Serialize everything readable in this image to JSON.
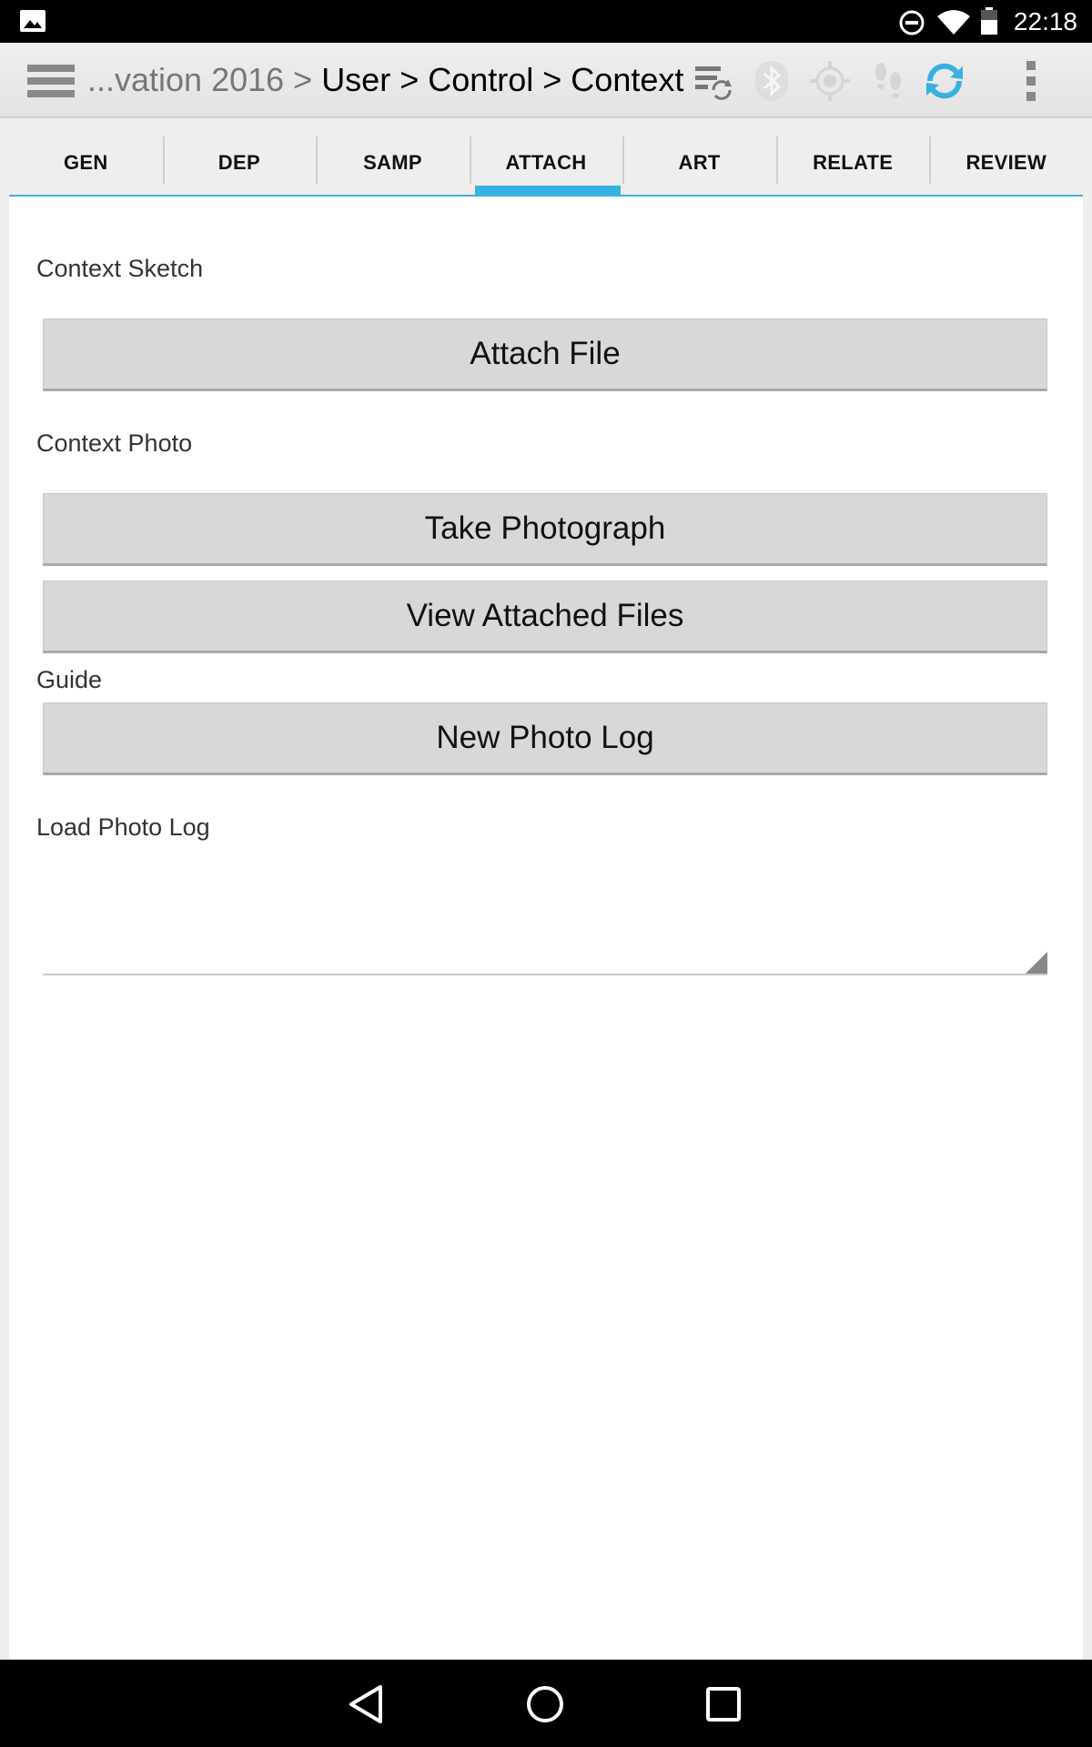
{
  "status_bar": {
    "time": "22:18",
    "icons": [
      "image-icon",
      "do-not-disturb-icon",
      "wifi-icon",
      "battery-icon"
    ]
  },
  "action_bar": {
    "breadcrumb_faded": "...vation 2016 > ",
    "breadcrumb_path": "User > Control > Context",
    "icons": [
      "menu-icon",
      "sync-list-icon",
      "bluetooth-icon",
      "gps-icon",
      "tracks-icon",
      "refresh-icon",
      "overflow-menu-icon"
    ],
    "accent_color": "#36b1e2"
  },
  "tabs": [
    {
      "label": "GEN",
      "active": false
    },
    {
      "label": "DEP",
      "active": false
    },
    {
      "label": "SAMP",
      "active": false
    },
    {
      "label": "ATTACH",
      "active": true
    },
    {
      "label": "ART",
      "active": false
    },
    {
      "label": "RELATE",
      "active": false
    },
    {
      "label": "REVIEW",
      "active": false
    }
  ],
  "form": {
    "context_sketch_label": "Context Sketch",
    "attach_file_button": "Attach File",
    "context_photo_label": "Context Photo",
    "take_photograph_button": "Take Photograph",
    "view_attached_files_button": "View Attached Files",
    "guide_label": "Guide",
    "new_photo_log_button": "New Photo Log",
    "load_photo_log_label": "Load Photo Log",
    "load_photo_log_value": ""
  },
  "nav_bar": {
    "icons": [
      "back-icon",
      "home-icon",
      "recents-icon"
    ]
  }
}
